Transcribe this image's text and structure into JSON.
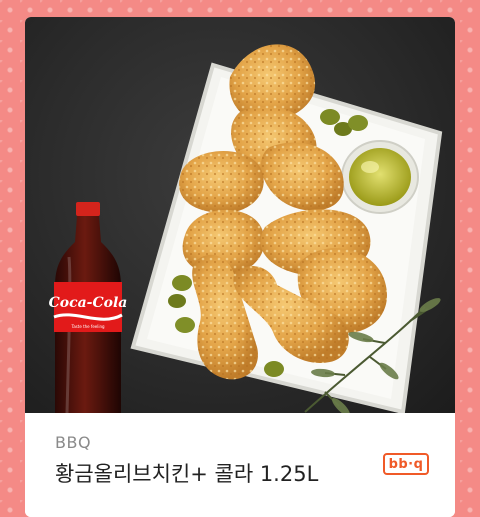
{
  "product": {
    "brand": "BBQ",
    "title": "황금올리브치킨+ 콜라 1.25L",
    "logo_text": "bb·q"
  },
  "photo": {
    "bottle_label": "Coca-Cola",
    "bottle_tagline": "Taste the feeling"
  },
  "colors": {
    "background": "#f48a86",
    "card": "#ffffff",
    "brand_accent": "#f05a28",
    "brand_text": "#8a8a8a",
    "title_text": "#222222"
  }
}
